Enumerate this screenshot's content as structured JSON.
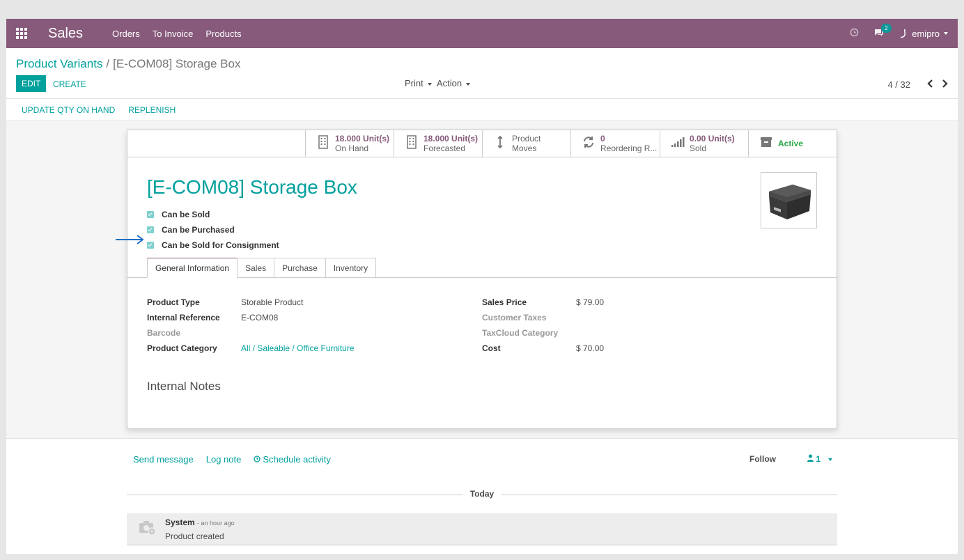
{
  "navbar": {
    "brand": "Sales",
    "menu": [
      "Orders",
      "To Invoice",
      "Products"
    ],
    "messages_count": "2",
    "user": "emipro"
  },
  "breadcrumb": {
    "parent": "Product Variants",
    "separator": "/",
    "current": "[E-COM08] Storage Box"
  },
  "toolbar": {
    "edit": "EDIT",
    "create": "CREATE",
    "print": "Print",
    "action": "Action",
    "pager": "4 / 32"
  },
  "header_buttons": {
    "update_qty": "UPDATE QTY ON HAND",
    "replenish": "REPLENISH"
  },
  "smart_buttons": [
    {
      "value": "18.000 Unit(s)",
      "label": "On Hand",
      "icon": "building-icon"
    },
    {
      "value": "18.000 Unit(s)",
      "label": "Forecasted",
      "icon": "building-icon"
    },
    {
      "value": "Product",
      "label": "Moves",
      "icon": "exchange-icon"
    },
    {
      "value": "0",
      "label": "Reordering R...",
      "icon": "refresh-icon"
    },
    {
      "value": "0.00 Unit(s)",
      "label": "Sold",
      "icon": "signal-icon"
    },
    {
      "value": "Active",
      "label": "",
      "icon": "archive-icon"
    }
  ],
  "product": {
    "title": "[E-COM08] Storage Box",
    "checks": [
      "Can be Sold",
      "Can be Purchased",
      "Can be Sold for Consignment"
    ]
  },
  "tabs": [
    "General Information",
    "Sales",
    "Purchase",
    "Inventory"
  ],
  "fields_left": [
    {
      "label": "Product Type",
      "value": "Storable Product"
    },
    {
      "label": "Internal Reference",
      "value": "E-COM08"
    },
    {
      "label": "Barcode",
      "value": ""
    },
    {
      "label": "Product Category",
      "value": "All / Saleable / Office Furniture"
    }
  ],
  "fields_right": [
    {
      "label": "Sales Price",
      "value": "$ 79.00"
    },
    {
      "label": "Customer Taxes",
      "value": ""
    },
    {
      "label": "TaxCloud Category",
      "value": ""
    },
    {
      "label": "Cost",
      "value": "$ 70.00"
    }
  ],
  "internal_notes": "Internal Notes",
  "chatter": {
    "send_message": "Send message",
    "log_note": "Log note",
    "schedule_activity": "Schedule activity",
    "follow": "Follow",
    "followers": "1",
    "today": "Today",
    "message": {
      "author": "System",
      "date": "- an hour ago",
      "body": "Product created"
    }
  },
  "colors": {
    "primary": "#00a09d",
    "navbar": "#875a7b"
  }
}
